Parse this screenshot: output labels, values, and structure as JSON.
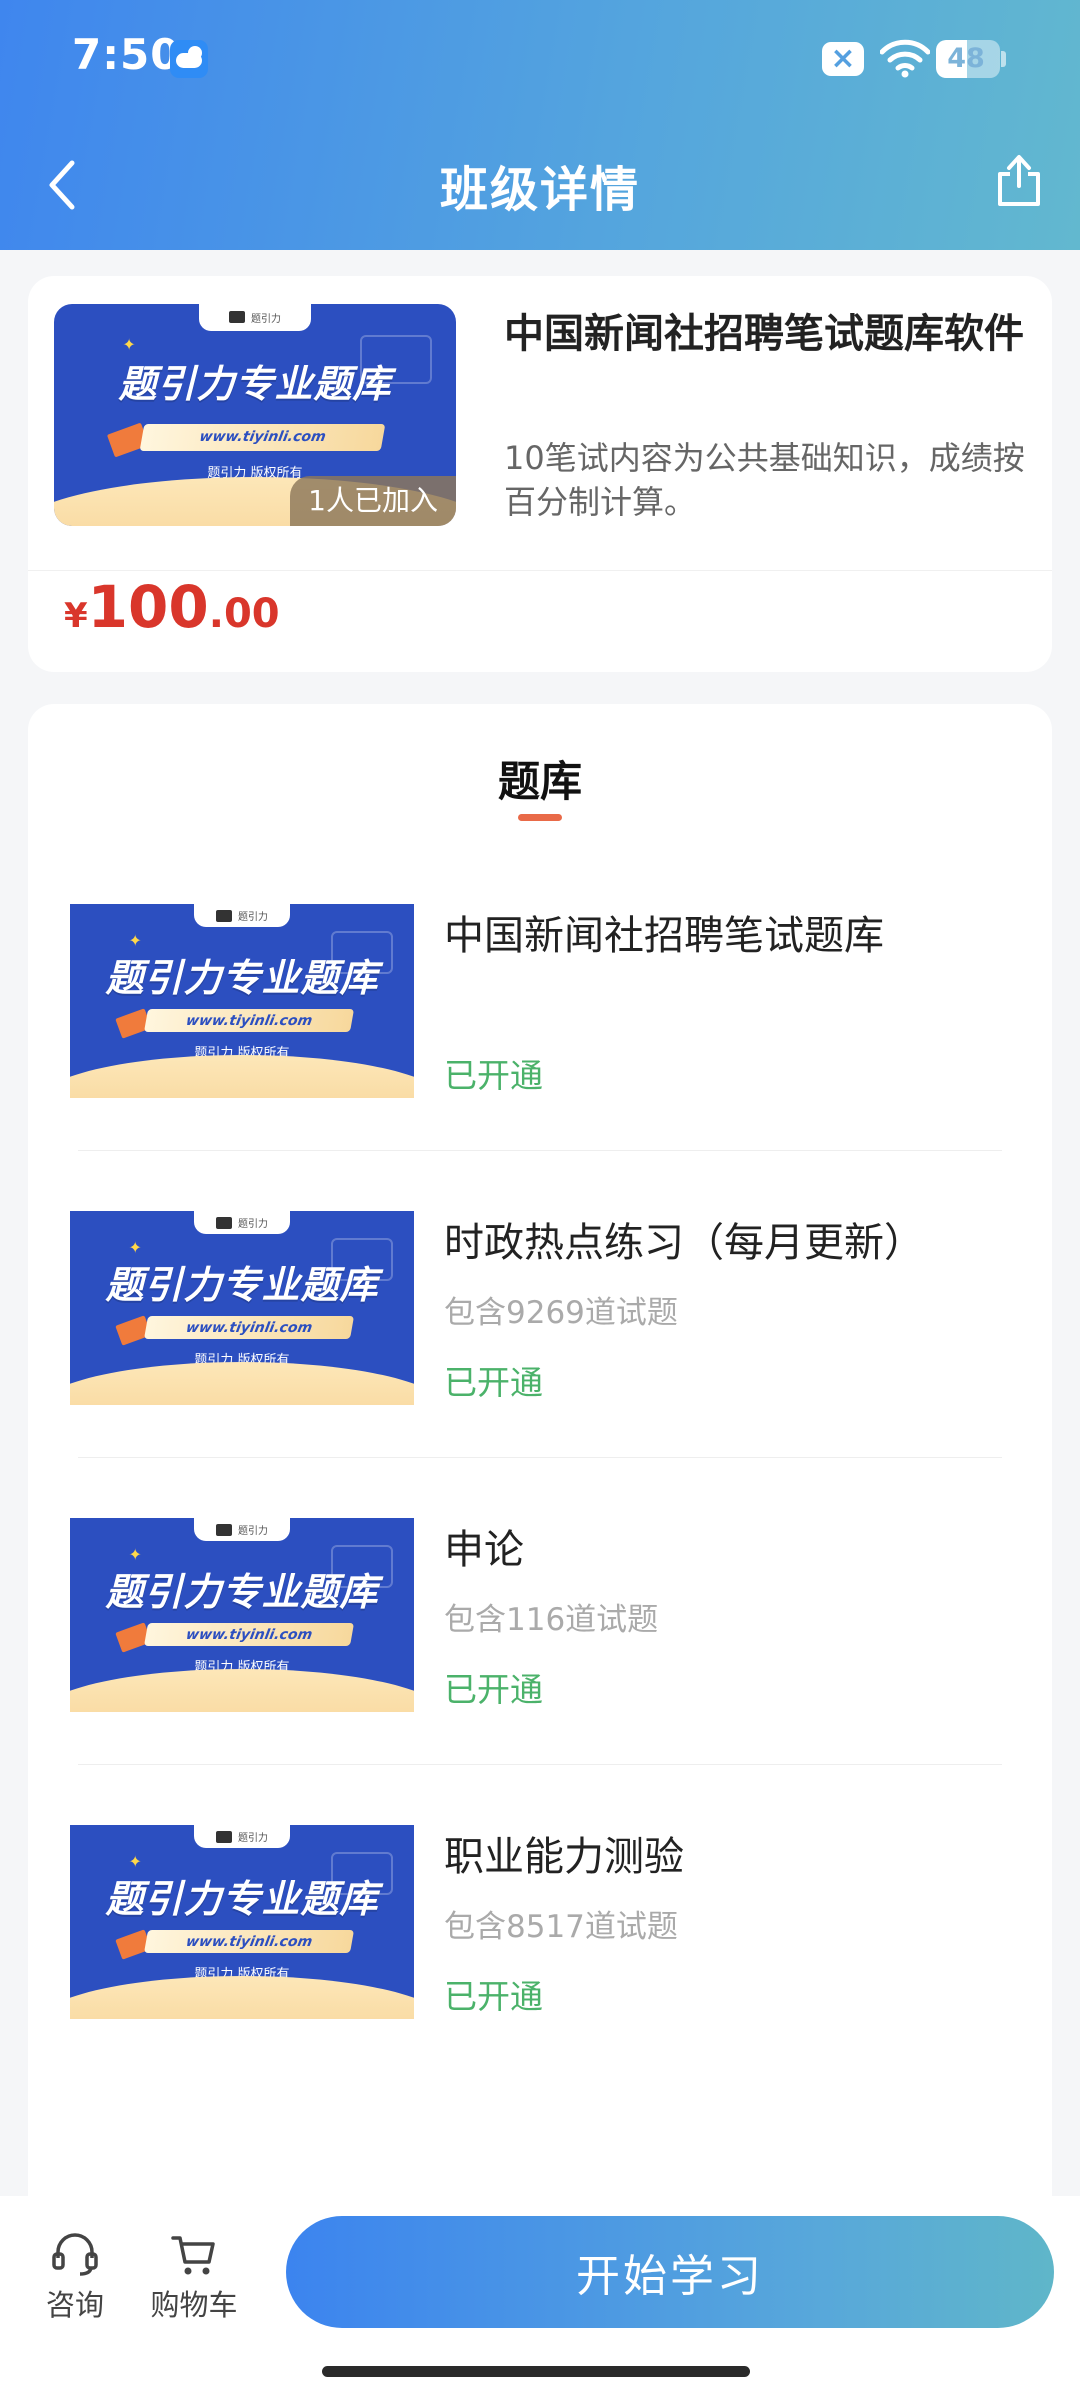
{
  "status_bar": {
    "time": "7:50",
    "battery": "48",
    "battery_level": 0.48
  },
  "header": {
    "title": "班级详情"
  },
  "thumb": {
    "slogan": "题引力专业题库",
    "url": "www.tiyinli.com",
    "copyright": "题引力 版权所有",
    "tab_text": "题引力"
  },
  "course": {
    "title": "中国新闻社招聘笔试题库软件",
    "description": "10笔试内容为公共基础知识，成绩按百分制计算。",
    "joined_badge": "1人已加入",
    "price_symbol": "¥",
    "price_integer": "100",
    "price_decimal": ".00"
  },
  "bank_section": {
    "tab_label": "题库",
    "items": [
      {
        "name": "中国新闻社招聘笔试题库",
        "count": "",
        "status": "已开通"
      },
      {
        "name": "时政热点练习（每月更新）",
        "count": "包含9269道试题",
        "status": "已开通"
      },
      {
        "name": "申论",
        "count": "包含116道试题",
        "status": "已开通"
      },
      {
        "name": "职业能力测验",
        "count": "包含8517道试题",
        "status": "已开通"
      }
    ]
  },
  "bottom_bar": {
    "consult_label": "咨询",
    "cart_label": "购物车",
    "start_label": "开始学习"
  },
  "colors": {
    "header_gradient_start": "#3f86ee",
    "header_gradient_end": "#62b8cf",
    "price_red": "#d9362b",
    "status_green": "#4bb26a",
    "tab_underline": "#e96a48"
  }
}
